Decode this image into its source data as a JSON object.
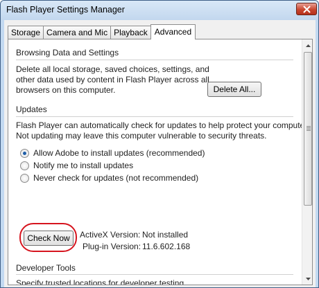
{
  "window": {
    "title": "Flash Player Settings Manager"
  },
  "tabs": [
    {
      "label": "Storage",
      "active": false
    },
    {
      "label": "Camera and Mic",
      "active": false
    },
    {
      "label": "Playback",
      "active": false
    },
    {
      "label": "Advanced",
      "active": true
    }
  ],
  "browsing": {
    "title": "Browsing Data and Settings",
    "lines": [
      "Delete all local storage, saved choices, settings, and",
      "other data used by content in Flash Player across all",
      "browsers on this computer."
    ],
    "delete_button": "Delete All..."
  },
  "updates": {
    "title": "Updates",
    "lines": [
      "Flash Player can automatically check for updates to help protect your computer.",
      "Not updating may leave this computer vulnerable to security threats."
    ],
    "options": [
      {
        "label": "Allow Adobe to install updates (recommended)",
        "checked": true
      },
      {
        "label": "Notify me to install updates",
        "checked": false
      },
      {
        "label": "Never check for updates (not recommended)",
        "checked": false
      }
    ],
    "check_now_button": "Check Now",
    "activex_label": "ActiveX Version:",
    "activex_value": "Not installed",
    "plugin_label": "Plug-in Version:",
    "plugin_value": "11.6.602.168"
  },
  "developer": {
    "title": "Developer Tools",
    "line": "Specify trusted locations for developer testing."
  },
  "colors": {
    "highlight_ring": "#d6141e",
    "radio_selected": "#1f5fa8",
    "close_button": "#c9462f"
  }
}
